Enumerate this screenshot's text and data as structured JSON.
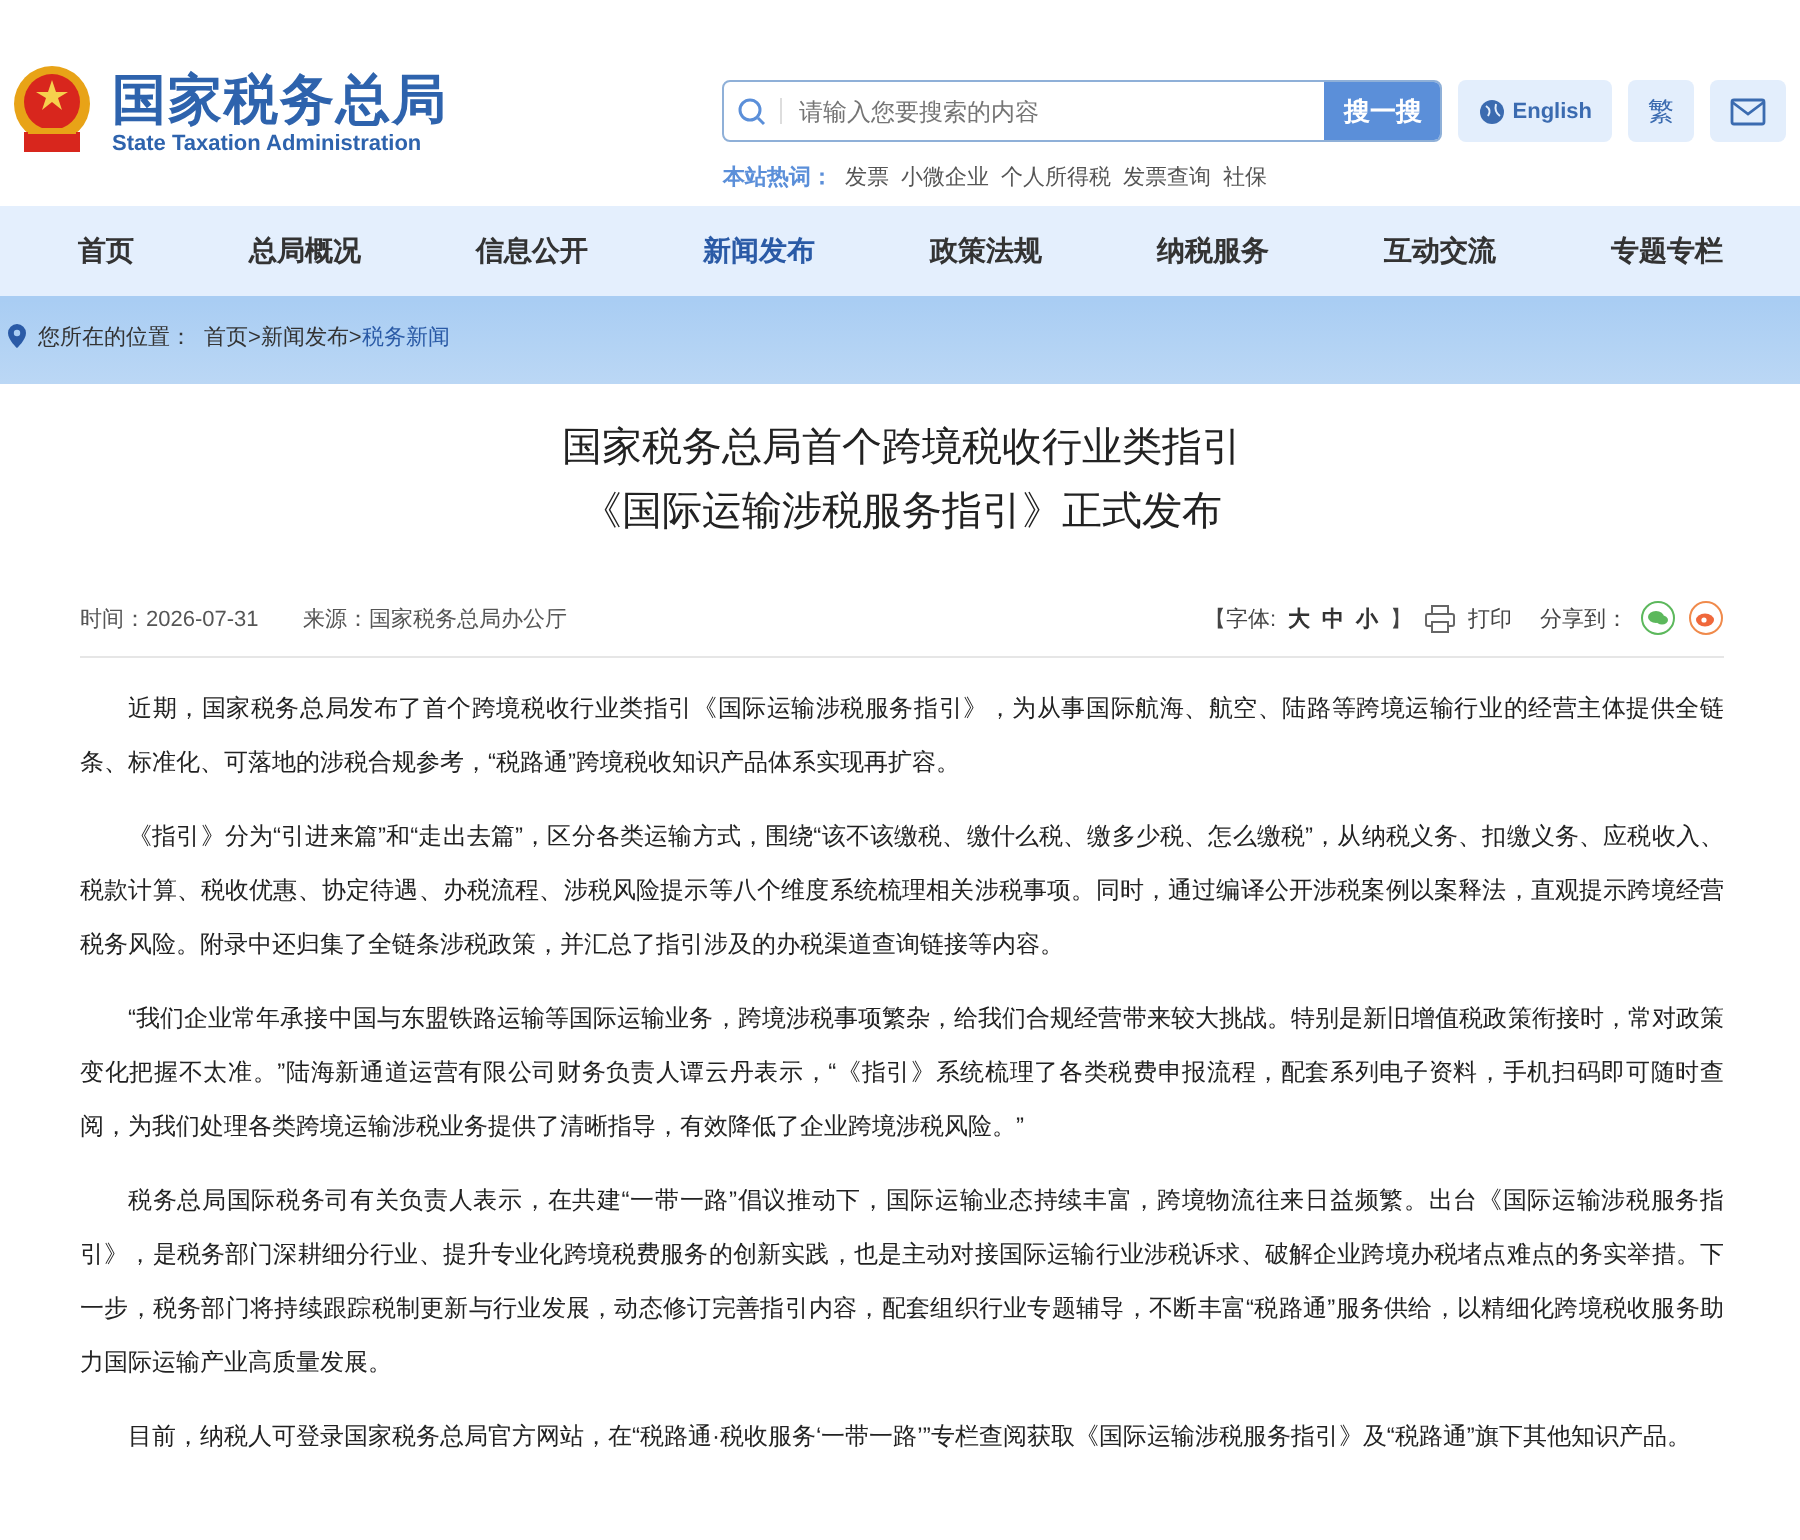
{
  "header": {
    "logo_title": "国家税务总局",
    "logo_subtitle": "State Taxation Administration",
    "search": {
      "placeholder": "请输入您要搜索的内容",
      "button": "搜一搜"
    },
    "english": "English",
    "traditional": "繁",
    "hot_label": "本站热词：",
    "hot_words": [
      "发票",
      "小微企业",
      "个人所得税",
      "发票查询",
      "社保"
    ]
  },
  "nav": [
    {
      "label": "首页",
      "selected": false
    },
    {
      "label": "总局概况",
      "selected": false
    },
    {
      "label": "信息公开",
      "selected": false
    },
    {
      "label": "新闻发布",
      "selected": true
    },
    {
      "label": "政策法规",
      "selected": false
    },
    {
      "label": "纳税服务",
      "selected": false
    },
    {
      "label": "互动交流",
      "selected": false
    },
    {
      "label": "专题专栏",
      "selected": false
    }
  ],
  "breadcrumb": {
    "label": "您所在的位置：",
    "items": [
      "首页>新闻发布>",
      "税务新闻"
    ]
  },
  "article": {
    "title_lines": [
      "国家税务总局首个跨境税收行业类指引",
      "《国际运输涉税服务指引》正式发布"
    ],
    "time": "时间：2026-07-31",
    "source": "来源：国家税务总局办公厅",
    "font_label": "【字体:",
    "font_sizes": [
      "大",
      "中",
      "小"
    ],
    "font_close": "】",
    "print": "打印",
    "share": "分享到：",
    "paragraphs": [
      "近期，国家税务总局发布了首个跨境税收行业类指引《国际运输涉税服务指引》，为从事国际航海、航空、陆路等跨境运输行业的经营主体提供全链条、标准化、可落地的涉税合规参考，“税路通”跨境税收知识产品体系实现再扩容。",
      "《指引》分为“引进来篇”和“走出去篇”，区分各类运输方式，围绕“该不该缴税、缴什么税、缴多少税、怎么缴税”，从纳税义务、扣缴义务、应税收入、税款计算、税收优惠、协定待遇、办税流程、涉税风险提示等八个维度系统梳理相关涉税事项。同时，通过编译公开涉税案例以案释法，直观提示跨境经营税务风险。附录中还归集了全链条涉税政策，并汇总了指引涉及的办税渠道查询链接等内容。",
      "“我们企业常年承接中国与东盟铁路运输等国际运输业务，跨境涉税事项繁杂，给我们合规经营带来较大挑战。特别是新旧增值税政策衔接时，常对政策变化把握不太准。”陆海新通道运营有限公司财务负责人谭云丹表示，“《指引》系统梳理了各类税费申报流程，配套系列电子资料，手机扫码即可随时查阅，为我们处理各类跨境运输涉税业务提供了清晰指导，有效降低了企业跨境涉税风险。”",
      "税务总局国际税务司有关负责人表示，在共建“一带一路”倡议推动下，国际运输业态持续丰富，跨境物流往来日益频繁。出台《国际运输涉税服务指引》，是税务部门深耕细分行业、提升专业化跨境税费服务的创新实践，也是主动对接国际运输行业涉税诉求、破解企业跨境办税堵点难点的务实举措。下一步，税务部门将持续跟踪税制更新与行业发展，动态修订完善指引内容，配套组织行业专题辅导，不断丰富“税路通”服务供给，以精细化跨境税收服务助力国际运输产业高质量发展。",
      "目前，纳税人可登录国家税务总局官方网站，在“税路通·税收服务‘一带一路’”专栏查阅获取《国际运输涉税服务指引》及“税路通”旗下其他知识产品。"
    ]
  }
}
